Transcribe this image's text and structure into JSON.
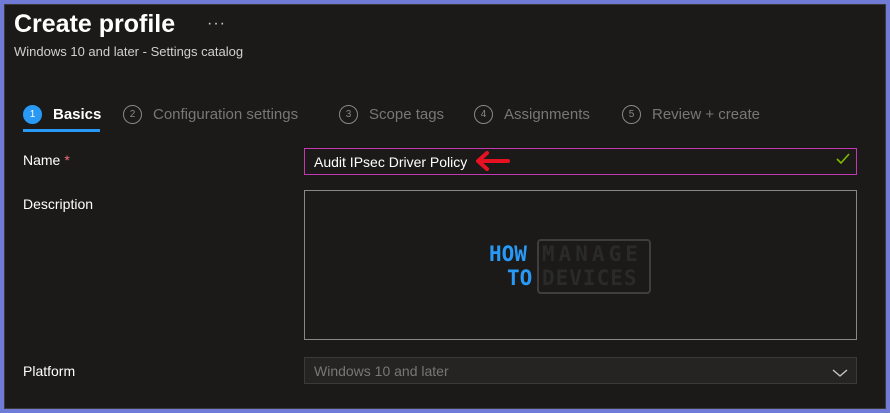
{
  "header": {
    "title": "Create profile",
    "more_label": "···",
    "subtitle": "Windows 10 and later - Settings catalog"
  },
  "steps": [
    {
      "number": "1",
      "label": "Basics",
      "active": true
    },
    {
      "number": "2",
      "label": "Configuration settings",
      "active": false
    },
    {
      "number": "3",
      "label": "Scope tags",
      "active": false
    },
    {
      "number": "4",
      "label": "Assignments",
      "active": false
    },
    {
      "number": "5",
      "label": "Review + create",
      "active": false
    }
  ],
  "form": {
    "name_label": "Name",
    "required_marker": "*",
    "name_value": "Audit IPsec Driver Policy",
    "description_label": "Description",
    "description_value": "",
    "platform_label": "Platform",
    "platform_value": "Windows 10 and later"
  },
  "watermark": {
    "how": "HOW",
    "to": "TO",
    "manage": "MANAGE",
    "devices": "DEVICES"
  },
  "colors": {
    "accent": "#2899f5",
    "focus_border": "#c239b3",
    "valid_check": "#7fba00",
    "annotation_arrow": "#e81123",
    "frame_border": "#6f7bd4"
  },
  "icons": {
    "valid": "check-icon",
    "dropdown": "chevron-down-icon",
    "annotation": "red-arrow-icon",
    "more": "ellipsis-icon"
  }
}
